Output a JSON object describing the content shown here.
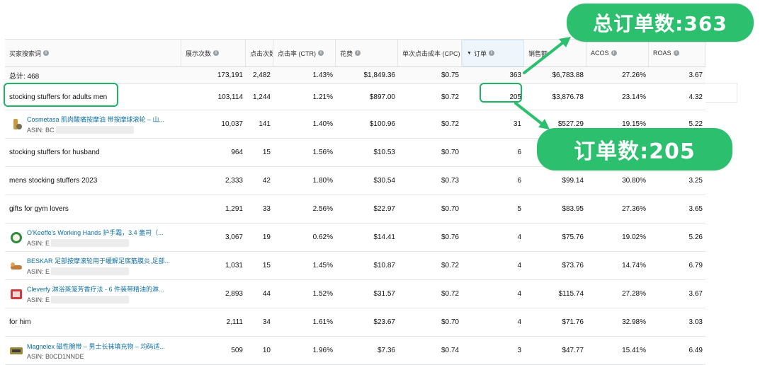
{
  "headers": [
    "买家搜索词",
    "展示次数",
    "点击次数",
    "点击率 (CTR)",
    "花费",
    "单次点击成本 (CPC)",
    "订单",
    "销售额",
    "ACOS",
    "ROAS"
  ],
  "total": {
    "label": "总计: 468",
    "impressions": "173,191",
    "clicks": "2,482",
    "ctr": "1.43%",
    "spend": "$1,849.36",
    "cpc": "$0.75",
    "orders": "363",
    "sales": "$6,783.88",
    "acos": "27.26%",
    "roas": "3.67"
  },
  "rows": [
    {
      "title": "stocking stuffers for adults men",
      "asin": "",
      "impressions": "103,114",
      "clicks": "1,244",
      "ctr": "1.21%",
      "spend": "$897.00",
      "cpc": "$0.72",
      "orders": "205",
      "sales": "$3,876.78",
      "acos": "23.14%",
      "roas": "4.32"
    },
    {
      "title": "Cosmetasa 肌肉酸痛按摩油 带按摩球滚轮 – 山...",
      "asin": "ASIN: BC",
      "impressions": "10,037",
      "clicks": "141",
      "ctr": "1.40%",
      "spend": "$100.96",
      "cpc": "$0.72",
      "orders": "31",
      "sales": "$527.29",
      "acos": "19.15%",
      "roas": "5.22"
    },
    {
      "title": "stocking stuffers for husband",
      "asin": "",
      "impressions": "964",
      "clicks": "15",
      "ctr": "1.56%",
      "spend": "$10.53",
      "cpc": "$0.70",
      "orders": "6",
      "sales": "",
      "acos": "",
      "roas": ""
    },
    {
      "title": "mens stocking stuffers 2023",
      "asin": "",
      "impressions": "2,333",
      "clicks": "42",
      "ctr": "1.80%",
      "spend": "$30.54",
      "cpc": "$0.73",
      "orders": "6",
      "sales": "$99.14",
      "acos": "30.80%",
      "roas": "3.25"
    },
    {
      "title": "gifts for gym lovers",
      "asin": "",
      "impressions": "1,291",
      "clicks": "33",
      "ctr": "2.56%",
      "spend": "$22.97",
      "cpc": "$0.70",
      "orders": "5",
      "sales": "$83.95",
      "acos": "27.36%",
      "roas": "3.65"
    },
    {
      "title": "O'Keeffe's Working Hands 护手霜，3.4 盎司（...",
      "asin": "ASIN: E",
      "impressions": "3,067",
      "clicks": "19",
      "ctr": "0.62%",
      "spend": "$14.41",
      "cpc": "$0.76",
      "orders": "4",
      "sales": "$75.76",
      "acos": "19.02%",
      "roas": "5.26"
    },
    {
      "title": "BESKAR 足部按摩滚轮用于缓解足底筋膜炎,足部...",
      "asin": "ASIN: E",
      "impressions": "1,031",
      "clicks": "15",
      "ctr": "1.45%",
      "spend": "$10.87",
      "cpc": "$0.72",
      "orders": "4",
      "sales": "$73.76",
      "acos": "14.74%",
      "roas": "6.79"
    },
    {
      "title": "Cleverfy 淋浴蒸笼芳香疗法 - 6 件装带精油的淋...",
      "asin": "ASIN: E",
      "impressions": "2,893",
      "clicks": "44",
      "ctr": "1.52%",
      "spend": "$31.57",
      "cpc": "$0.72",
      "orders": "4",
      "sales": "$115.74",
      "acos": "27.28%",
      "roas": "3.67"
    },
    {
      "title": "for him",
      "asin": "",
      "impressions": "2,111",
      "clicks": "34",
      "ctr": "1.61%",
      "spend": "$23.67",
      "cpc": "$0.70",
      "orders": "4",
      "sales": "$71.76",
      "acos": "32.98%",
      "roas": "3.03"
    },
    {
      "title": "Magnelex 磁性腕带 – 男士长袜填充物 – 均码适...",
      "asin": "ASIN: B0CD1NNDE",
      "impressions": "509",
      "clicks": "10",
      "ctr": "1.96%",
      "spend": "$7.36",
      "cpc": "$0.74",
      "orders": "3",
      "sales": "$47.77",
      "acos": "15.41%",
      "roas": "6.49"
    }
  ],
  "annotations": {
    "total_orders": "总订单数:363",
    "orders": "订单数:205"
  },
  "colors": {
    "accent_green": "#2bbf6e",
    "link_blue": "#0f6fa3"
  }
}
